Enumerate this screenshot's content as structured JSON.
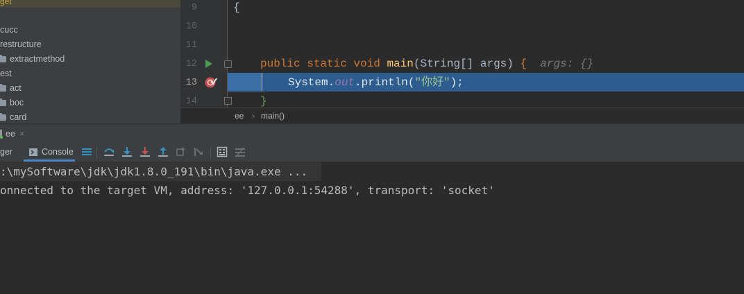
{
  "project_tree": {
    "selected_label": "get",
    "items": [
      {
        "label": "cucc",
        "folder": false
      },
      {
        "label": "restructure",
        "folder": false
      },
      {
        "label": "extractmethod",
        "folder": true
      },
      {
        "label": "est",
        "folder": false
      },
      {
        "label": "act",
        "folder": true
      },
      {
        "label": "boc",
        "folder": true
      },
      {
        "label": "card",
        "folder": true
      }
    ]
  },
  "editor": {
    "line_numbers": [
      "9",
      "10",
      "11",
      "12",
      "13",
      "14"
    ],
    "line9_brace": "{",
    "line12": {
      "kw1": "public",
      "kw2": "static",
      "kw3": "void",
      "method": "main",
      "params": "(String[] args) ",
      "brace": "{",
      "hint": "args: {}"
    },
    "line13": {
      "obj": "System.",
      "field": "out",
      "call": ".println(",
      "string": "\"你好\"",
      "end": ");"
    },
    "line14_brace": "}"
  },
  "breadcrumb": {
    "class": "ee",
    "method": "main()"
  },
  "debug": {
    "session_tab": "ee",
    "debugger_tab": "ger",
    "console_tab": "Console"
  },
  "console": {
    "lines": [
      ":\\mySoftware\\jdk\\jdk1.8.0_191\\bin\\java.exe ...",
      "onnected to the target VM, address: '127.0.0.1:54288', transport: 'socket'"
    ]
  },
  "colors": {
    "accent": "#2d5d8f",
    "tab_underline": "#4a88c7"
  }
}
